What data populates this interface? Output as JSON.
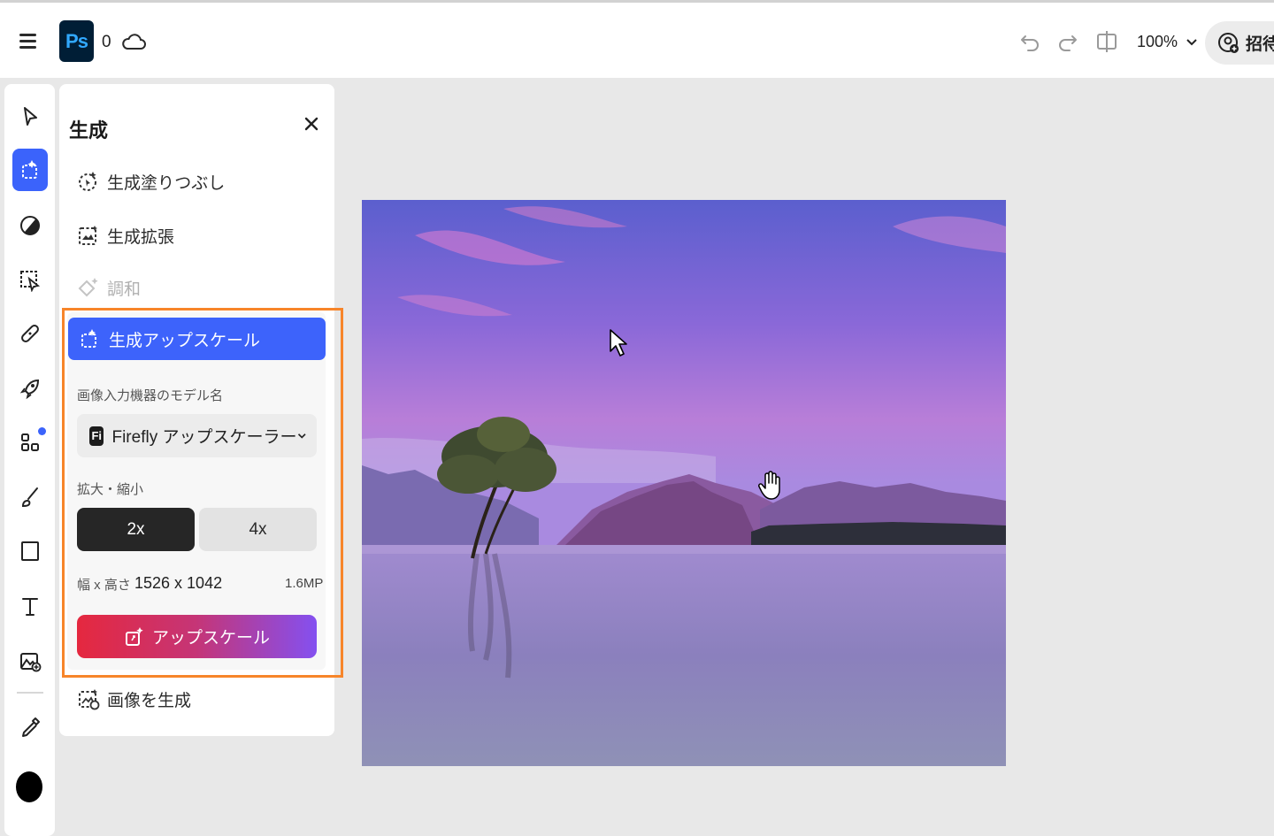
{
  "header": {
    "app_logo": "Ps",
    "doc_count": "0",
    "zoom": "100%",
    "invite_label": "招待"
  },
  "toolbar": {
    "tools": [
      "select-icon",
      "generate-icon",
      "adjust-icon",
      "selection-icon",
      "heal-icon",
      "quick-actions-icon",
      "add-ons-icon",
      "brush-icon",
      "shape-icon",
      "text-icon",
      "generate-image-icon",
      "eyedropper-icon"
    ],
    "foreground_color": "#000000"
  },
  "panel": {
    "title": "生成",
    "items": {
      "fill": "生成塗りつぶし",
      "expand": "生成拡張",
      "harmonize": "調和",
      "upscale": "生成アップスケール",
      "generate_image": "画像を生成"
    },
    "upscale": {
      "model_label": "画像入力機器のモデル名",
      "model_badge": "Fi",
      "model_value": "Firefly アップスケーラー",
      "scale_label": "拡大・縮小",
      "scale_2x": "2x",
      "scale_4x": "4x",
      "dimensions_label": "幅 x 高さ",
      "dimensions_value": "1526 x 1042",
      "megapixels": "1.6MP",
      "button": "アップスケール"
    }
  },
  "colors": {
    "accent_blue": "#3d63fb",
    "highlight_orange": "#f7852a"
  }
}
